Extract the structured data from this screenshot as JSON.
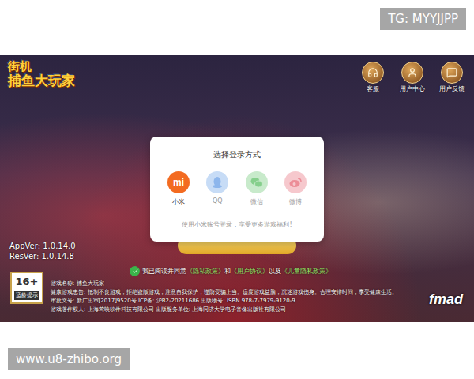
{
  "watermarks": {
    "top": "TG: MYYJJPP",
    "bottom": "www.u8-zhibo.org"
  },
  "game": {
    "logo": [
      "街机",
      "捕鱼大玩家"
    ],
    "top_buttons": [
      {
        "label": "客服"
      },
      {
        "label": "用户中心"
      },
      {
        "label": "用户反馈"
      }
    ],
    "versions": [
      "AppVer: 1.0.14.0",
      "ResVer: 1.0.14.8"
    ],
    "age_rating": {
      "rating": "16+",
      "label": "适龄提示"
    },
    "agreement": {
      "checked": true,
      "segments": [
        {
          "text": "我已阅读并同意",
          "link": false
        },
        {
          "text": "《隐私政策》",
          "link": true
        },
        {
          "text": "和",
          "link": false
        },
        {
          "text": "《用户协议》",
          "link": true
        },
        {
          "text": "以及",
          "link": false
        },
        {
          "text": "《儿童隐私政策》",
          "link": true
        }
      ]
    },
    "legal_lines": [
      "游戏名称: 捕鱼大玩家",
      "健康游戏忠告: 抵制不良游戏，拒绝盗版游戏，注意自我保护，谨防受骗上当。适度游戏益脑，沉迷游戏伤身。合理安排时间，享受健康生活。",
      "审批文号: 新广出审[2017]9520号 ICP备: 沪B2-20211686 出版物号: ISBN 978-7-7979-9120-9",
      "游戏著作权人: 上海莺映软件科技有限公司 出版服务单位: 上海同济大学电子音像出版社有限公司"
    ],
    "publisher_logo": "fmad"
  },
  "login_dialog": {
    "title": "选择登录方式",
    "options": [
      {
        "label": "小米",
        "glyph": "mi",
        "kind": "xiaomi",
        "selected": true,
        "color": "#f36b21"
      },
      {
        "label": "QQ",
        "glyph": "",
        "kind": "qq",
        "selected": false,
        "color": "#c7dcf6"
      },
      {
        "label": "微信",
        "glyph": "",
        "kind": "wechat",
        "selected": false,
        "color": "#c8eacb"
      },
      {
        "label": "微博",
        "glyph": "",
        "kind": "weibo",
        "selected": false,
        "color": "#f6c8cd"
      }
    ],
    "hint": "使用小米账号登录，享受更多游戏福利!"
  }
}
